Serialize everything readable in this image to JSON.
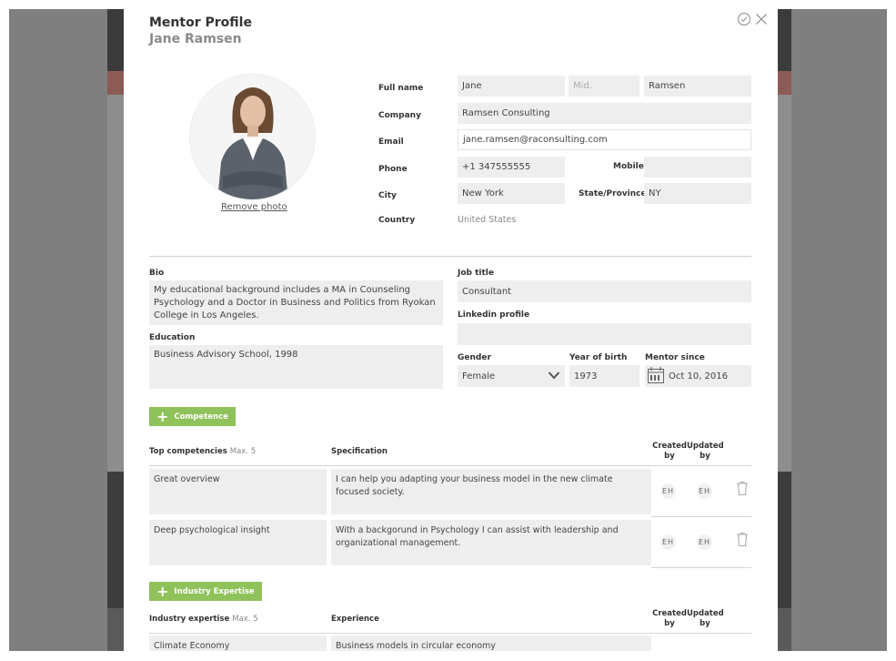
{
  "header": {
    "title": "Mentor Profile",
    "name": "Jane Ramsen"
  },
  "icons": {
    "approve": "check-circle-icon",
    "close": "close-icon"
  },
  "photo": {
    "remove_label": "Remove photo"
  },
  "labels": {
    "full_name": "Full name",
    "company": "Company",
    "email": "Email",
    "phone": "Phone",
    "mobile": "Mobile",
    "city": "City",
    "state": "State/Province",
    "country": "Country",
    "bio": "Bio",
    "education": "Education",
    "job_title": "Job title",
    "linkedin": "Linkedin profile",
    "gender": "Gender",
    "year_of_birth": "Year of birth",
    "mentor_since": "Mentor since"
  },
  "fields": {
    "first_name": "Jane",
    "middle_name_placeholder": "Mid.",
    "last_name": "Ramsen",
    "company": "Ramsen Consulting",
    "email": "jane.ramsen@raconsulting.com",
    "phone": "+1 347555555",
    "mobile": "",
    "city": "New York",
    "state": "NY",
    "country": "United States",
    "bio": "My educational background includes a MA in Counseling Psychology and a Doctor in Business and Politics from Ryokan College in Los Angeles.",
    "education": "Business Advisory School, 1998",
    "job_title": "Consultant",
    "linkedin": "",
    "gender": "Female",
    "year_of_birth": "1973",
    "mentor_since": "Oct 10, 2016"
  },
  "competence": {
    "add_label": "Competence",
    "header_top": "Top competencies",
    "header_max": "Max. 5",
    "header_spec": "Specification",
    "header_created": "Created",
    "header_updated": "Updated",
    "header_by": "by",
    "rows": [
      {
        "name": "Great overview",
        "spec": "I can help you adapting your business model in the new climate focused society.",
        "created_by": "EH",
        "updated_by": "EH"
      },
      {
        "name": "Deep psychological insight",
        "spec": "With a backgorund in Psychology I can assist with leadership and organizational management.",
        "created_by": "EH",
        "updated_by": "EH"
      }
    ]
  },
  "industry": {
    "add_label": "Industry Expertise",
    "header_top": "Industry expertise",
    "header_max": "Max. 5",
    "header_exp": "Experience",
    "header_created": "Created",
    "header_updated": "Updated",
    "header_by": "by",
    "rows": [
      {
        "name": "Climate Economy",
        "experience": "Business models in circular economy"
      }
    ]
  },
  "colors": {
    "accent_green": "#8fc25a",
    "field_bg": "#eeeeee"
  }
}
